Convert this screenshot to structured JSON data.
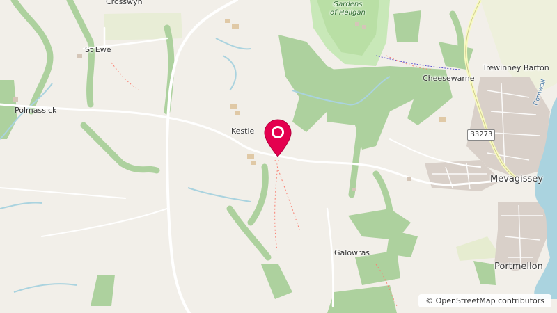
{
  "map": {
    "places": {
      "crosswyn": "Crosswyn",
      "st_ewe": "St Ewe",
      "polmassick": "Polmassick",
      "kestle": "Kestle",
      "cheesewarne": "Cheesewarne",
      "trewinney_barton": "Trewinney Barton",
      "mevagissey": "Mevagissey",
      "portmellon": "Portmellon",
      "galowras": "Galowras"
    },
    "park_label_line1": "Gardens",
    "park_label_line2": "of Heligan",
    "road_ref": "B3273",
    "coast_label": "Cornwall"
  },
  "marker": {
    "icon": "map-pin-icon",
    "color": "#e4004f"
  },
  "attribution": "© OpenStreetMap contributors",
  "colors": {
    "land": "#f2efe9",
    "forest": "#add19e",
    "park": "#c8facc",
    "water": "#aad3df",
    "urban": "#d9d0c9"
  }
}
